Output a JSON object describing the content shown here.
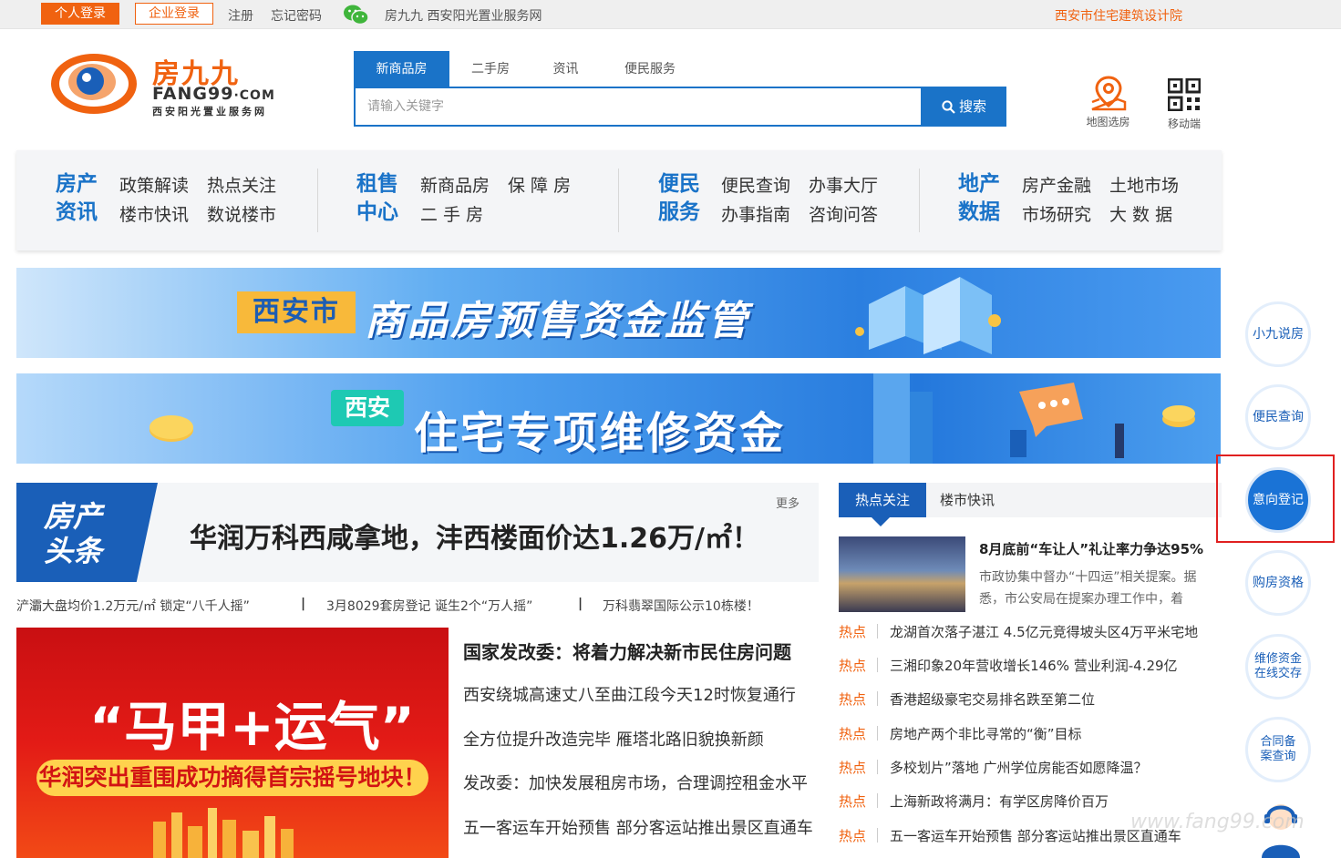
{
  "topbar": {
    "personal_login": "个人登录",
    "company_login": "企业登录",
    "register": "注册",
    "forgot_password": "忘记密码",
    "site_name": "房九九 西安阳光置业服务网",
    "right_link": "西安市住宅建筑设计院"
  },
  "logo": {
    "cn": "房九九",
    "en": "FANG99",
    "en_suffix": "·COM",
    "sub": "西安阳光置业服务网"
  },
  "search": {
    "tabs": [
      "新商品房",
      "二手房",
      "资讯",
      "便民服务"
    ],
    "placeholder": "请输入关键字",
    "button": "搜索"
  },
  "header_icons": {
    "map": "地图选房",
    "mobile": "移动端"
  },
  "nav": {
    "groups": [
      {
        "cat": [
          "房产",
          "资讯"
        ],
        "items": [
          "政策解读",
          "热点关注",
          "楼市快讯",
          "数说楼市"
        ]
      },
      {
        "cat": [
          "租售",
          "中心"
        ],
        "items": [
          "新商品房",
          "保 障 房",
          "二 手 房"
        ]
      },
      {
        "cat": [
          "便民",
          "服务"
        ],
        "items": [
          "便民查询",
          "办事大厅",
          "办事指南",
          "咨询问答"
        ]
      },
      {
        "cat": [
          "地产",
          "数据"
        ],
        "items": [
          "房产金融",
          "土地市场",
          "市场研究",
          "大 数 据"
        ]
      }
    ]
  },
  "banners": {
    "b1_tag": "西安市",
    "b1_title": "商品房预售资金监管",
    "b2_tag": "西安",
    "b2_title": "住宅专项维修资金"
  },
  "headline": {
    "badge": [
      "房产",
      "头条"
    ],
    "title": "华润万科西咸拿地，沣西楼面价达1.26万/㎡！",
    "more": "更多",
    "subs": [
      "浐灞大盘均价1.2万元/㎡ 锁定“八千人摇”",
      "3月8029套房登记 诞生2个“万人摇”",
      "万科翡翠国际公示10栋楼！"
    ],
    "sep": "|"
  },
  "feature": {
    "title": "“马甲+运气”",
    "subtitle": "华润突出重围成功摘得首宗摇号地块！"
  },
  "news": {
    "main": "国家发改委：将着力解决新市民住房问题",
    "items": [
      "西安绕城高速丈八至曲江段今天12时恢复通行",
      "全方位提升改造完毕 雁塔北路旧貌换新颜",
      "发改委：加快发展租房市场，合理调控租金水平",
      "五一客运车开始预售 部分客运站推出景区直通车"
    ]
  },
  "hot": {
    "tabs": [
      "热点关注",
      "楼市快讯"
    ],
    "top_title": "8月底前“车让人”礼让率力争达95%",
    "top_desc": "市政协集中督办“十四运”相关提案。据悉，市公安局在提案办理工作中，着",
    "tag": "热点",
    "items": [
      "龙湖首次落子湛江 4.5亿元竞得坡头区4万平米宅地",
      "三湘印象20年营收增长146% 营业利润-4.29亿",
      "香港超级豪宅交易排名跌至第二位",
      "房地产两个非比寻常的“衡”目标",
      "多校划片”落地 广州学位房能否如愿降温？",
      "上海新政将满月：有学区房降价百万",
      "五一客运车开始预售 部分客运站推出景区直通车"
    ]
  },
  "sidebar": {
    "items": [
      "小九说房",
      "便民查询",
      "意向登记",
      "购房资格",
      "维修资金在线交存",
      "合同备案查询"
    ]
  },
  "colors": {
    "brand_orange": "#f06210",
    "brand_blue": "#1a73c8",
    "highlight_red": "#e02020"
  }
}
